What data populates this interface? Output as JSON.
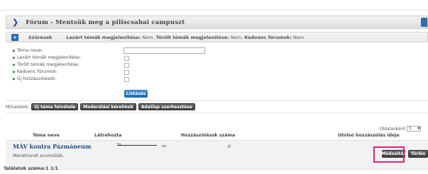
{
  "forum": {
    "title": "Fórum - Mentsük meg a piliscsabai campuszt"
  },
  "filters": {
    "toggle_icon": "plus-icon",
    "label": "Szűrések",
    "summary_closed": "Lezárt témák megjelenítése:",
    "summary_closed_val": "Nem,",
    "summary_deleted": "Törölt témák megjelenítése:",
    "summary_deleted_val": "Nem,",
    "summary_fav": "Kedvenc fórumok:",
    "summary_fav_val": "Nem"
  },
  "form": {
    "topic_name_label": "Téma neve:",
    "topic_name_value": "",
    "closed_label": "Lezárt témák megjelenítése:",
    "deleted_label": "Törölt témák megjelenítése:",
    "fav_label": "Kedvenc fórumok:",
    "new_posts_label": "Új hozzászólások:",
    "list_button": "Listázás"
  },
  "operations": {
    "label": "Műveletek:",
    "new_topic": "Új téma felvétele",
    "moderation": "Moderálási kérelmek",
    "edit_data": "Adatlap szerkesztése"
  },
  "pagination": {
    "per_page_label": "Oldalanként",
    "per_page_value": "5"
  },
  "table": {
    "headers": [
      "Téma neve",
      "Létrehozta",
      "Hozzászólások száma",
      "Utolsó hozzászólás ideje"
    ],
    "rows": [
      {
        "topic": "MÁV kontra Pázmáneum",
        "creator_a": "Sz",
        "creator_b": "ny",
        "count": "0",
        "desc": "Menetrendi anomáliák.",
        "modify": "Módosítás",
        "delete": "Törlés"
      }
    ]
  },
  "results": {
    "label": "Találatok száma:1 1/1"
  }
}
